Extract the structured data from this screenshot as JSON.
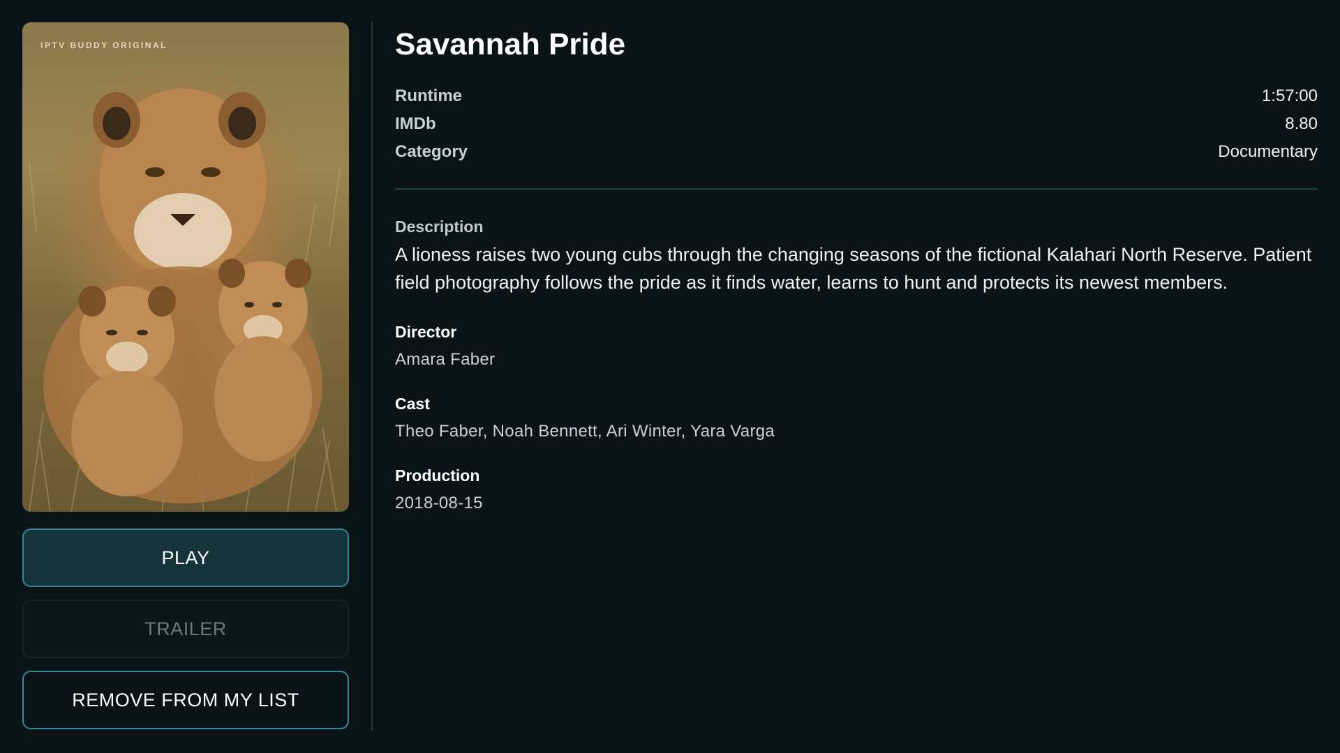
{
  "poster": {
    "badge": "IPTV BUDDY ORIGINAL",
    "subject": "lioness with two cubs"
  },
  "actions": {
    "play": "PLAY",
    "trailer": "TRAILER",
    "remove": "REMOVE FROM MY LIST"
  },
  "movie": {
    "title": "Savannah Pride",
    "runtime_label": "Runtime",
    "runtime": "1:57:00",
    "imdb_label": "IMDb",
    "imdb": "8.80",
    "category_label": "Category",
    "category": "Documentary",
    "description_label": "Description",
    "description": "A lioness raises two young cubs through the changing seasons of the fictional Kalahari North Reserve. Patient field photography follows the pride as it finds water, learns to hunt and protects its newest members.",
    "director_label": "Director",
    "director": "Amara Faber",
    "cast_label": "Cast",
    "cast": "Theo Faber, Noah Bennett, Ari Winter, Yara Varga",
    "production_label": "Production",
    "production": "2018-08-15"
  },
  "colors": {
    "background": "#0a1416",
    "accent": "#2f8c94",
    "play_bg": "#14343a"
  }
}
